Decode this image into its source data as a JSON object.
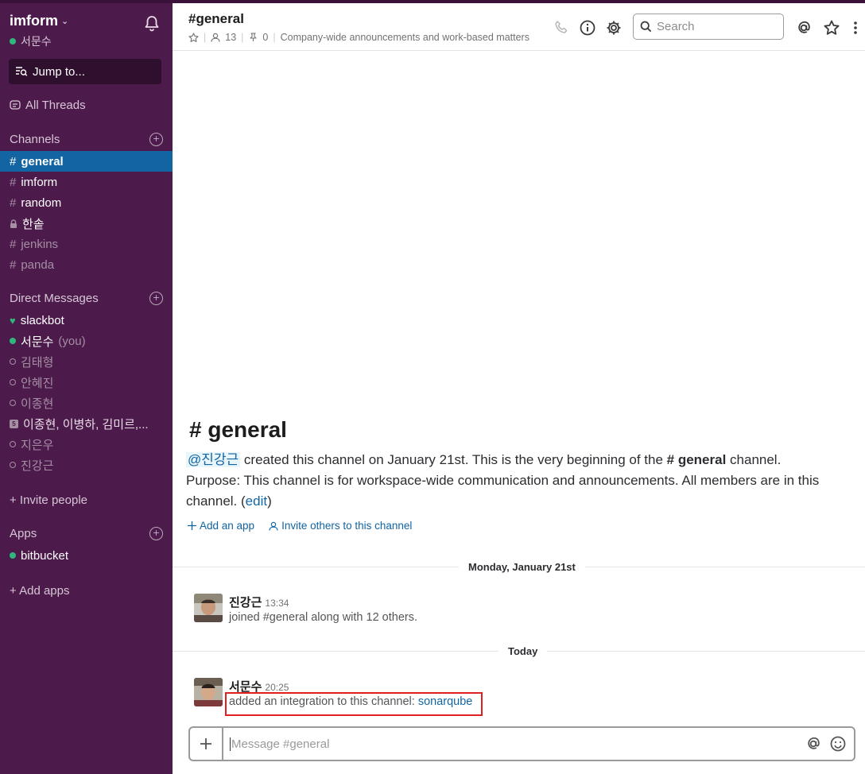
{
  "sidebar": {
    "team_name": "imform",
    "user_name": "서문수",
    "jump_label": "Jump to...",
    "all_threads": "All Threads",
    "channels_heading": "Channels",
    "channels": [
      {
        "name": "general",
        "active": true
      },
      {
        "name": "imform"
      },
      {
        "name": "random"
      },
      {
        "name": "한솥",
        "private": true
      },
      {
        "name": "jenkins",
        "muted": true
      },
      {
        "name": "panda",
        "muted": true
      }
    ],
    "dm_heading": "Direct Messages",
    "dms": [
      {
        "name": "slackbot"
      },
      {
        "name": "서문수",
        "suffix": "(you)"
      },
      {
        "name": "김태형"
      },
      {
        "name": "안혜진"
      },
      {
        "name": "이종현"
      },
      {
        "name": "이종현, 이병하, 김미르,...",
        "group_count": "5"
      },
      {
        "name": "지은우"
      },
      {
        "name": "진강근"
      }
    ],
    "invite_people": "+ Invite people",
    "apps_heading": "Apps",
    "apps": [
      {
        "name": "bitbucket"
      }
    ],
    "add_apps": "+ Add apps"
  },
  "header": {
    "channel_title": "#general",
    "members_count": "13",
    "pins_count": "0",
    "topic": "Company-wide announcements and work-based matters",
    "search_placeholder": "Search"
  },
  "intro": {
    "title": "# general",
    "creator": "@진강근",
    "created_text": " created this channel on January 21st. This is the very beginning of the ",
    "channel_ref": "# general",
    "channel_suffix": " channel.",
    "purpose": "Purpose: This channel is for workspace-wide communication and announcements. All members are in this channel. (",
    "edit": "edit",
    "purpose_end": ")",
    "add_app": "Add an app",
    "invite_others": "Invite others to this channel"
  },
  "days": {
    "first": "Monday, January 21st",
    "second": "Today"
  },
  "messages": [
    {
      "author": "진강근",
      "time": "13:34",
      "text": "joined #general along with 12 others."
    },
    {
      "author": "서문수",
      "time": "20:25",
      "text_prefix": "added an integration to this channel: ",
      "link": "sonarqube"
    }
  ],
  "composer": {
    "placeholder": "Message #general"
  },
  "colors": {
    "sidebar_bg": "#4d1a4c",
    "active_channel": "#1264a3",
    "presence_green": "#2fb67c",
    "highlight_red": "#e02020"
  }
}
